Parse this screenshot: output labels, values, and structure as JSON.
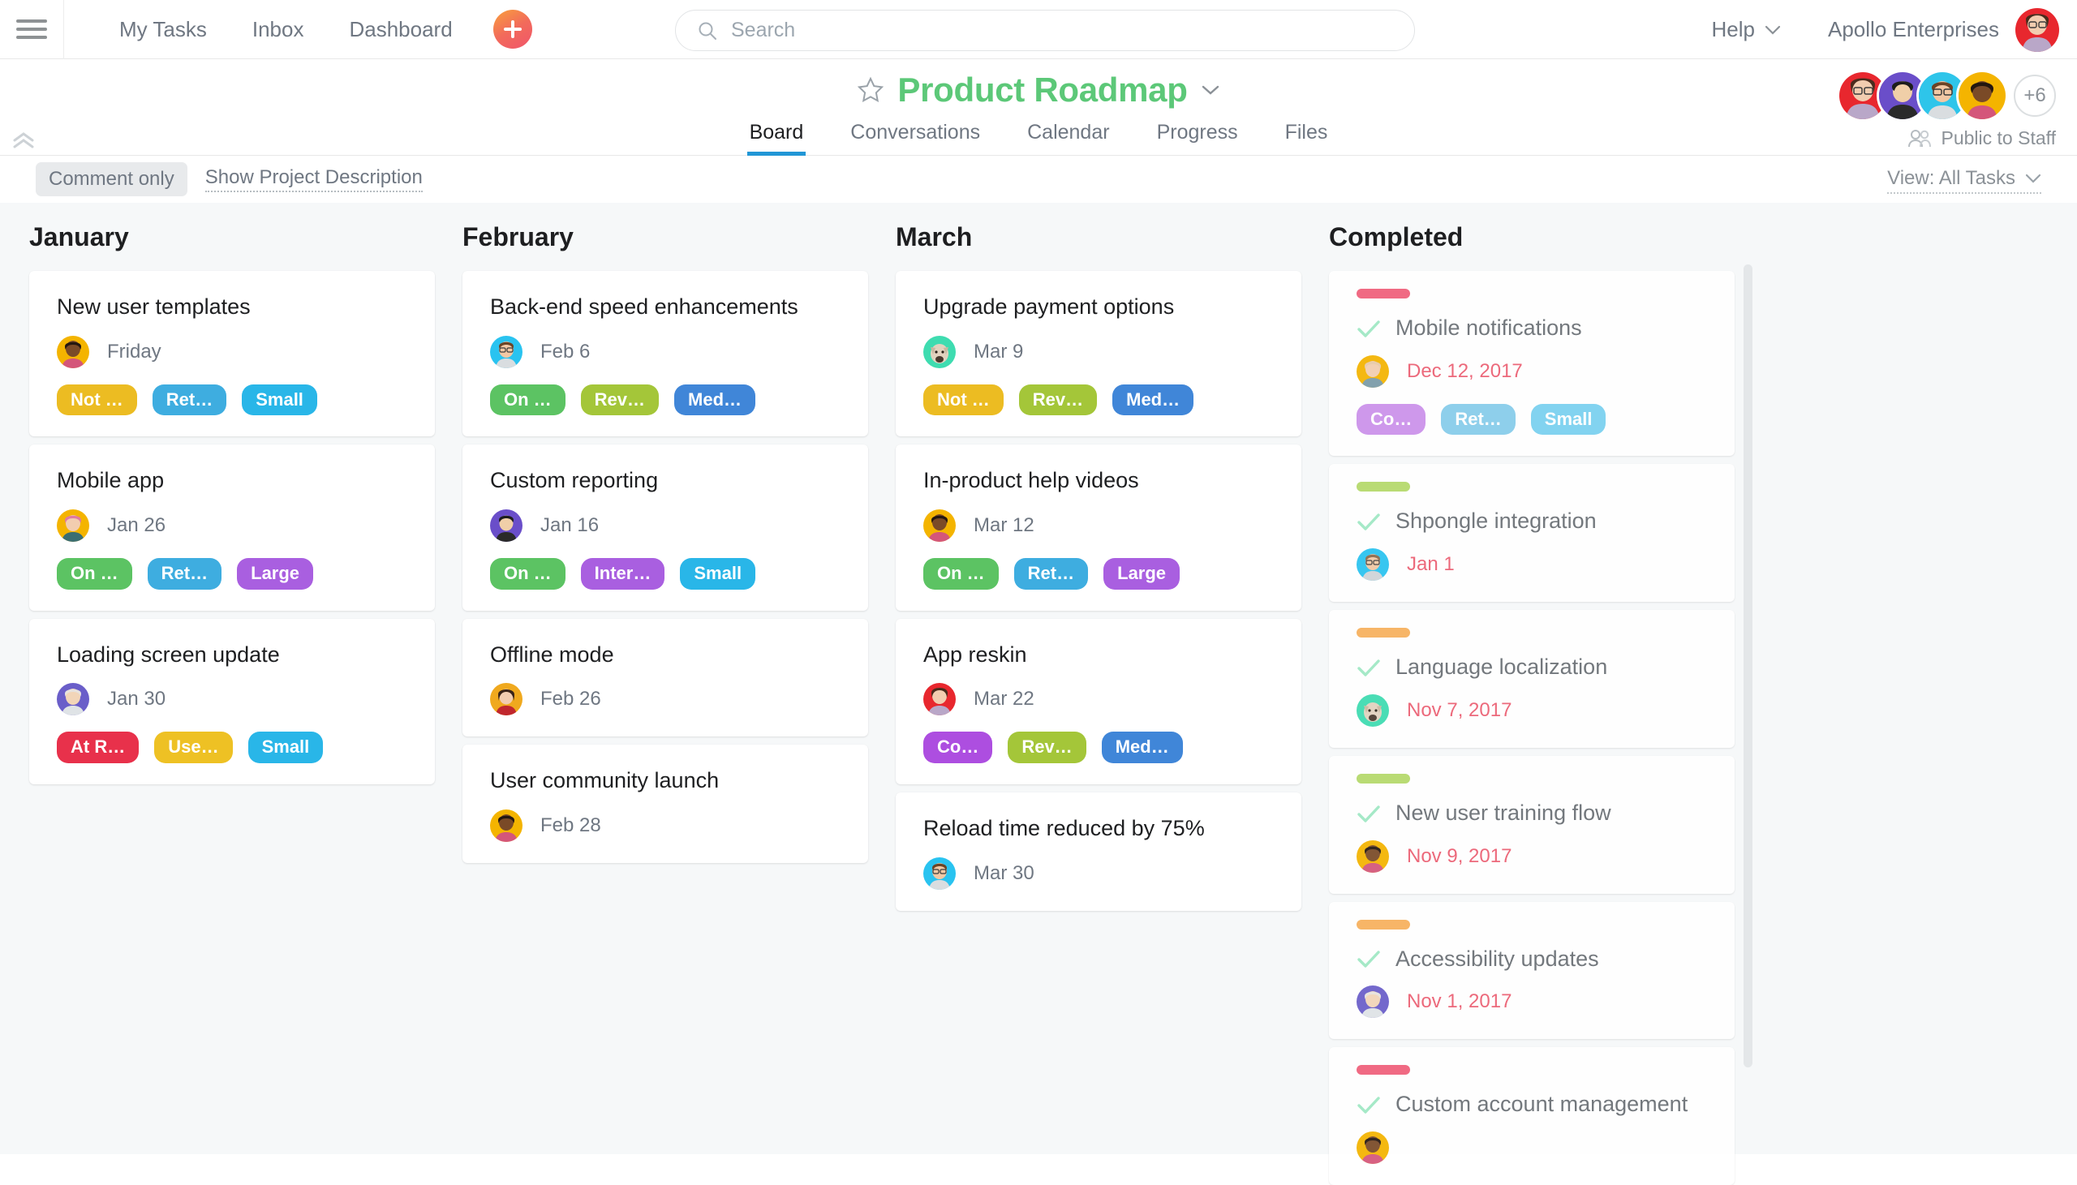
{
  "topnav": {
    "menu_icon": "hamburger-icon",
    "links": [
      {
        "label": "My Tasks"
      },
      {
        "label": "Inbox"
      },
      {
        "label": "Dashboard"
      }
    ],
    "add_icon": "plus-icon",
    "search": {
      "icon": "search-icon",
      "placeholder": "Search",
      "value": ""
    },
    "help_label": "Help",
    "help_chevron": "chevron-down-icon",
    "org_label": "Apollo Enterprises",
    "user_avatar_color": "#e8272e"
  },
  "project": {
    "star_icon": "star-outline-icon",
    "title": "Product Roadmap",
    "title_chevron": "chevron-down-icon",
    "title_color": "#5cc878",
    "tabs": [
      {
        "label": "Board",
        "active": true
      },
      {
        "label": "Conversations",
        "active": false
      },
      {
        "label": "Calendar",
        "active": false
      },
      {
        "label": "Progress",
        "active": false
      },
      {
        "label": "Files",
        "active": false
      }
    ],
    "active_tab_underline": "#2196d6",
    "members": [
      {
        "avatar_color": "#e8272e"
      },
      {
        "avatar_color": "#6a4ec9"
      },
      {
        "avatar_color": "#2ec5ea"
      },
      {
        "avatar_color": "#f4b400"
      }
    ],
    "members_overflow": "+6",
    "privacy_icon": "people-icon",
    "privacy_label": "Public to Staff"
  },
  "toolbar": {
    "comment_only_label": "Comment only",
    "show_description_label": "Show Project Description",
    "view_label": "View: All Tasks",
    "view_chevron": "chevron-down-icon",
    "collapse_icon": "double-chevron-up-icon"
  },
  "board": {
    "columns": [
      {
        "title": "January",
        "cards": [
          {
            "title": "New user templates",
            "date": "Friday",
            "avatar_color": "#f4b400",
            "tags": [
              {
                "label": "Not …",
                "color": "#ecbc22"
              },
              {
                "label": "Ret…",
                "color": "#3eade0"
              },
              {
                "label": "Small",
                "color": "#29b6e8"
              }
            ]
          },
          {
            "title": "Mobile app",
            "date": "Jan 26",
            "avatar_color": "#f4b400",
            "tags": [
              {
                "label": "On …",
                "color": "#5cc363"
              },
              {
                "label": "Ret…",
                "color": "#3eade0"
              },
              {
                "label": "Large",
                "color": "#a95fe0"
              }
            ]
          },
          {
            "title": "Loading screen update",
            "date": "Jan 30",
            "avatar_color": "#6a5ec9",
            "tags": [
              {
                "label": "At R…",
                "color": "#e8314b"
              },
              {
                "label": "Use…",
                "color": "#eec124"
              },
              {
                "label": "Small",
                "color": "#29b6e8"
              }
            ]
          }
        ]
      },
      {
        "title": "February",
        "cards": [
          {
            "title": "Back-end speed enhancements",
            "date": "Feb 6",
            "avatar_color": "#29c3f0",
            "tags": [
              {
                "label": "On …",
                "color": "#5cc363"
              },
              {
                "label": "Rev…",
                "color": "#a4c639"
              },
              {
                "label": "Med…",
                "color": "#4086d8"
              }
            ]
          },
          {
            "title": "Custom reporting",
            "date": "Jan 16",
            "avatar_color": "#6a4ec9",
            "tags": [
              {
                "label": "On …",
                "color": "#5cc363"
              },
              {
                "label": "Inter…",
                "color": "#a95fe0"
              },
              {
                "label": "Small",
                "color": "#29b6e8"
              }
            ]
          },
          {
            "title": "Offline mode",
            "date": "Feb 26",
            "avatar_color": "#f0a91e",
            "tags": []
          },
          {
            "title": "User community launch",
            "date": "Feb 28",
            "avatar_color": "#f4b400",
            "tags": []
          }
        ]
      },
      {
        "title": "March",
        "cards": [
          {
            "title": "Upgrade payment options",
            "date": "Mar 9",
            "avatar_color": "#3edcb0",
            "tags": [
              {
                "label": "Not …",
                "color": "#ecbc22"
              },
              {
                "label": "Rev…",
                "color": "#a4c639"
              },
              {
                "label": "Med…",
                "color": "#4086d8"
              }
            ]
          },
          {
            "title": "In-product help videos",
            "date": "Mar 12",
            "avatar_color": "#f4b400",
            "tags": [
              {
                "label": "On …",
                "color": "#5cc363"
              },
              {
                "label": "Ret…",
                "color": "#3eade0"
              },
              {
                "label": "Large",
                "color": "#a95fe0"
              }
            ]
          },
          {
            "title": "App reskin",
            "date": "Mar 22",
            "avatar_color": "#e8272e",
            "tags": [
              {
                "label": "Co…",
                "color": "#ad4ee0"
              },
              {
                "label": "Rev…",
                "color": "#a4c639"
              },
              {
                "label": "Med…",
                "color": "#4086d8"
              }
            ]
          },
          {
            "title": "Reload time reduced by 75%",
            "date": "Mar 30",
            "avatar_color": "#29c3f0",
            "tags": []
          }
        ]
      },
      {
        "title": "Completed",
        "scrollbar": true,
        "cards": [
          {
            "completed": true,
            "bar_color": "#f0607b",
            "check_icon": "check-icon",
            "title": "Mobile notifications",
            "date": "Dec 12, 2017",
            "avatar_color": "#f4b400",
            "tags": [
              {
                "label": "Co…",
                "color": "#ad4ee0"
              },
              {
                "label": "Ret…",
                "color": "#3eade0"
              },
              {
                "label": "Small",
                "color": "#29b6e8"
              }
            ]
          },
          {
            "completed": true,
            "bar_color": "#b5d96a",
            "check_icon": "check-icon",
            "title": "Shpongle integration",
            "date": "Jan 1",
            "avatar_color": "#29c3f0",
            "tags": []
          },
          {
            "completed": true,
            "bar_color": "#f8b15c",
            "check_icon": "check-icon",
            "title": "Language localization",
            "date": "Nov 7, 2017",
            "avatar_color": "#3edcb0",
            "tags": []
          },
          {
            "completed": true,
            "bar_color": "#b5d96a",
            "check_icon": "check-icon",
            "title": "New user training flow",
            "date": "Nov 9, 2017",
            "avatar_color": "#f4b400",
            "tags": []
          },
          {
            "completed": true,
            "bar_color": "#f8b15c",
            "check_icon": "check-icon",
            "title": "Accessibility updates",
            "date": "Nov 1, 2017",
            "avatar_color": "#6a5ec9",
            "tags": []
          },
          {
            "completed": true,
            "bar_color": "#f0607b",
            "check_icon": "check-icon",
            "title": "Custom account management",
            "date": "",
            "avatar_color": "#f4b400",
            "tags": []
          }
        ]
      }
    ]
  }
}
